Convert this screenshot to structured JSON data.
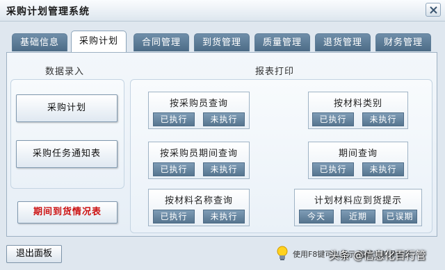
{
  "window": {
    "title": "采购计划管理系统"
  },
  "tabs": [
    {
      "label": "基础信息",
      "active": false
    },
    {
      "label": "采购计划",
      "active": true
    },
    {
      "label": "合同管理",
      "active": false
    },
    {
      "label": "到货管理",
      "active": false
    },
    {
      "label": "质量管理",
      "active": false
    },
    {
      "label": "退货管理",
      "active": false
    },
    {
      "label": "财务管理",
      "active": false
    }
  ],
  "data_entry": {
    "header": "数据录入",
    "buttons": [
      "采购计划",
      "采购任务通知表"
    ],
    "special_button": "期间到货情况表"
  },
  "reports": {
    "header": "报表打印",
    "queries": [
      {
        "title": "按采购员查询",
        "actions": [
          "已执行",
          "未执行"
        ]
      },
      {
        "title": "按材料类别",
        "actions": [
          "已执行",
          "未执行"
        ]
      },
      {
        "title": "按采购员期间查询",
        "actions": [
          "已执行",
          "未执行"
        ]
      },
      {
        "title": "期间查询",
        "actions": [
          "已执行",
          "未执行"
        ]
      },
      {
        "title": "按材料名称查询",
        "actions": [
          "已执行",
          "未执行"
        ]
      },
      {
        "title": "计划材料应到货提示",
        "actions": [
          "今天",
          "近期",
          "已误期"
        ]
      }
    ]
  },
  "footer": {
    "exit_button": "退出面板",
    "hint": "使用F8键可以显示/隐藏当前导航页",
    "watermark": "头条 @信息化百行管"
  },
  "colors": {
    "tab_bg": "#5a7a95",
    "sub_button_bg": "#5f7f99",
    "red_text": "#cc1111"
  }
}
